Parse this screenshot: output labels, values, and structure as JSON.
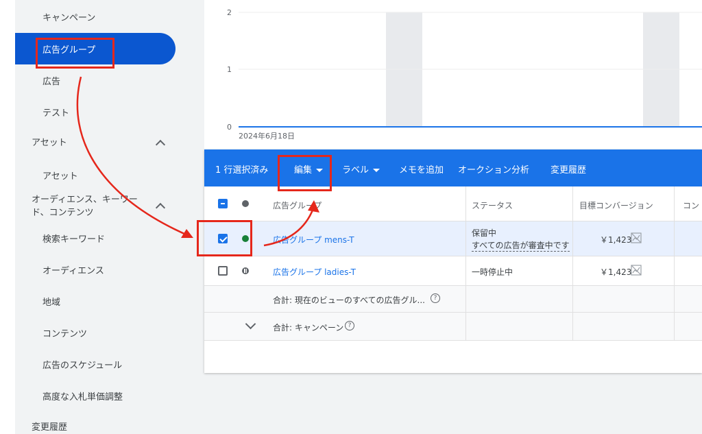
{
  "sidebar": {
    "items": [
      {
        "label": "キャンペーン"
      },
      {
        "label": "広告グループ"
      },
      {
        "label": "広告"
      },
      {
        "label": "テスト"
      },
      {
        "label": "アセット"
      },
      {
        "label": "アセット"
      },
      {
        "label": "オーディエンス、キーワード、コンテンツ"
      },
      {
        "label": "検索キーワード"
      },
      {
        "label": "オーディエンス"
      },
      {
        "label": "地域"
      },
      {
        "label": "コンテンツ"
      },
      {
        "label": "広告のスケジュール"
      },
      {
        "label": "高度な入札単価調整"
      },
      {
        "label": "変更履歴"
      }
    ],
    "section_audience_line1": "オーディエンス、キーワー",
    "section_audience_line2": "ド、コンテンツ"
  },
  "chart": {
    "y_ticks": [
      "2",
      "1",
      "0"
    ],
    "date_label": "2024年6月18日"
  },
  "action_bar": {
    "selected_count": "1 行選択済み",
    "edit": "編集",
    "label": "ラベル",
    "add_memo": "メモを追加",
    "auction_insights": "オークション分析",
    "change_history": "変更履歴"
  },
  "table": {
    "headers": {
      "ad_group": "広告グループ",
      "status": "ステータス",
      "target_conversion": "目標コンバージョン",
      "next": "コン"
    },
    "rows": [
      {
        "name": "広告グループ mens-T",
        "status_line1": "保留中",
        "status_line2": "すべての広告が審査中です",
        "target": "￥1,423",
        "selected": true,
        "status_color": "#188038"
      },
      {
        "name": "広告グループ ladies-T",
        "status_line1": "一時停止中",
        "target": "￥1,423",
        "selected": false,
        "status_color": "#5f6368"
      }
    ],
    "total_view": "合計: 現在のビューのすべての広告グル...",
    "total_campaign": "合計: キャンペーン"
  },
  "icons": {
    "expand": "chevron-down-icon",
    "collapse": "caret-up-icon",
    "help": "help-icon",
    "chart": "chart-off-icon"
  },
  "colors": {
    "primary": "#1a73e8",
    "active_nav": "#0b57d0",
    "annotation": "#e5271b"
  }
}
